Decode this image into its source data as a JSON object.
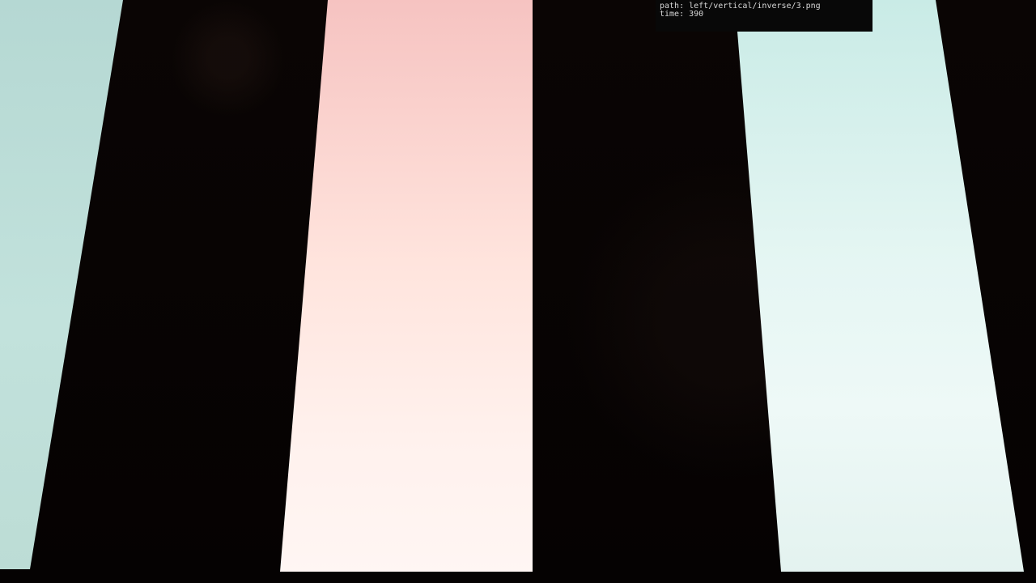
{
  "overlay": {
    "path_line": "path: left/vertical/inverse/3.png",
    "time_line": "time: 390"
  },
  "colors": {
    "background": "#070303",
    "left_stripe": "#bddcd6",
    "middle_stripe": "#ffe8e2",
    "right_stripe": "#e5f6f3",
    "overlay_bg": "#080808",
    "overlay_text": "#d7d7d7"
  }
}
